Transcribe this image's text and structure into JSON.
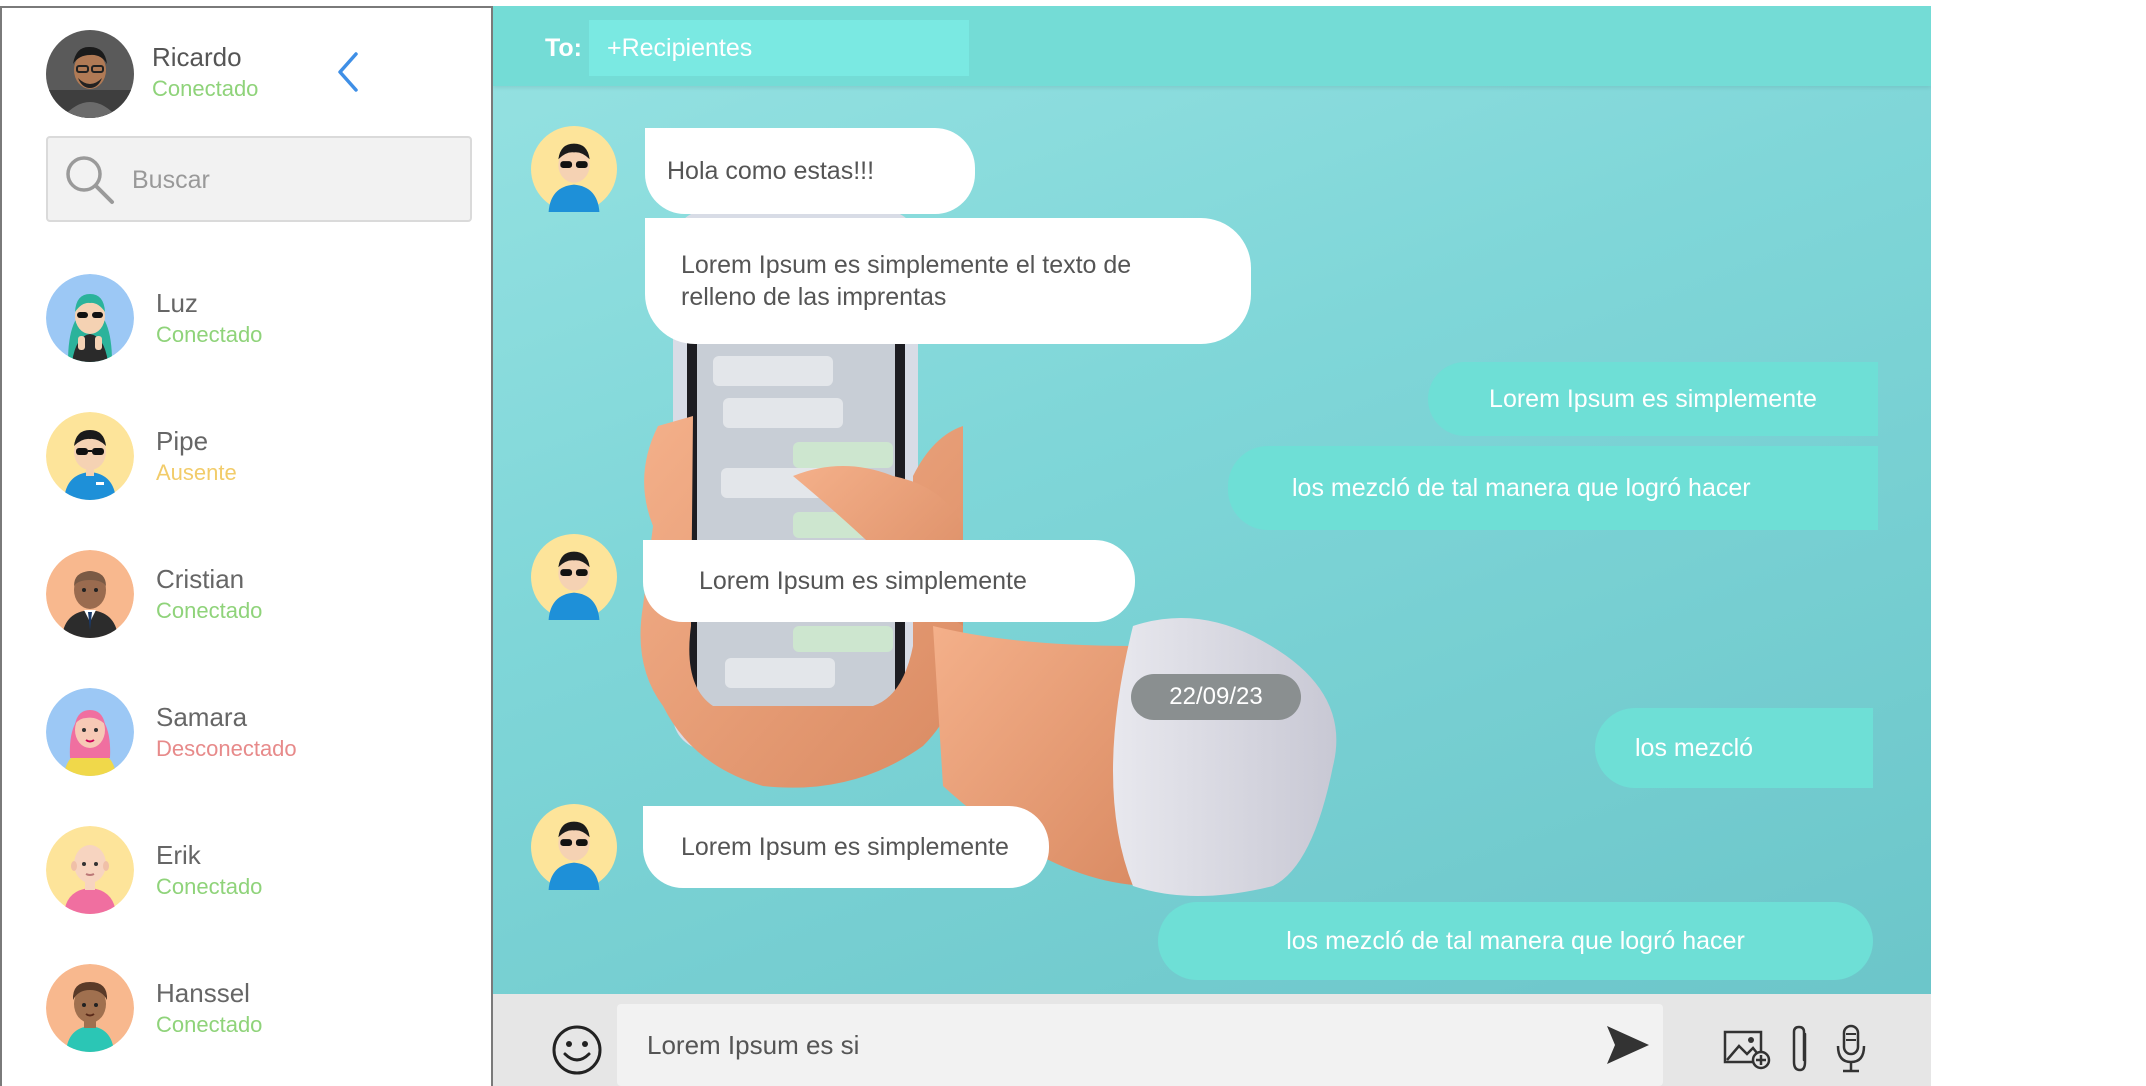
{
  "sidebar": {
    "user": {
      "name": "Ricardo",
      "status": "Conectado",
      "avatar_icon": "user-avatar-icon"
    },
    "search": {
      "placeholder": "Buscar"
    },
    "contacts": [
      {
        "name": "Luz",
        "status": "Conectado",
        "status_color": "#8fd37a",
        "avatar_bg": "#9cc8f5"
      },
      {
        "name": "Pipe",
        "status": "Ausente",
        "status_color": "#f2cc6a",
        "avatar_bg": "#fde49a"
      },
      {
        "name": "Cristian",
        "status": "Conectado",
        "status_color": "#8fd37a",
        "avatar_bg": "#f8b88e"
      },
      {
        "name": "Samara",
        "status": "Desconectado",
        "status_color": "#e78a8a",
        "avatar_bg": "#9cc8f5"
      },
      {
        "name": "Erik",
        "status": "Conectado",
        "status_color": "#8fd37a",
        "avatar_bg": "#fde49a"
      },
      {
        "name": "Hanssel",
        "status": "Conectado",
        "status_color": "#8fd37a",
        "avatar_bg": "#f8b88e"
      }
    ]
  },
  "chat": {
    "to_label": "To:",
    "recipients_placeholder": "+Recipientes",
    "messages": [
      {
        "direction": "in",
        "text": "Hola como estas!!!"
      },
      {
        "direction": "in",
        "text": "Lorem Ipsum es simplemente el texto de relleno de las imprentas"
      },
      {
        "direction": "out",
        "text": "Lorem Ipsum es simplemente"
      },
      {
        "direction": "out",
        "text": "los mezcló de tal manera que logró hacer"
      },
      {
        "direction": "in",
        "text": "Lorem Ipsum es simplemente"
      },
      {
        "direction": "out",
        "text": "los mezcló"
      },
      {
        "direction": "in",
        "text": "Lorem Ipsum es simplemente"
      },
      {
        "direction": "out",
        "text": "los mezcló de tal manera que logró hacer"
      }
    ],
    "date_separator": "22/09/23"
  },
  "composer": {
    "value": "Lorem Ipsum es si",
    "icons": [
      "emoji-icon",
      "send-icon",
      "add-image-icon",
      "attachment-icon",
      "microphone-icon"
    ]
  },
  "colors": {
    "accent": "#74dcd6",
    "outgoing_bubble": "#6edfd6",
    "online": "#8fd37a",
    "away": "#f2cc6a",
    "offline": "#e78a8a",
    "back_arrow": "#3f8fe6"
  }
}
